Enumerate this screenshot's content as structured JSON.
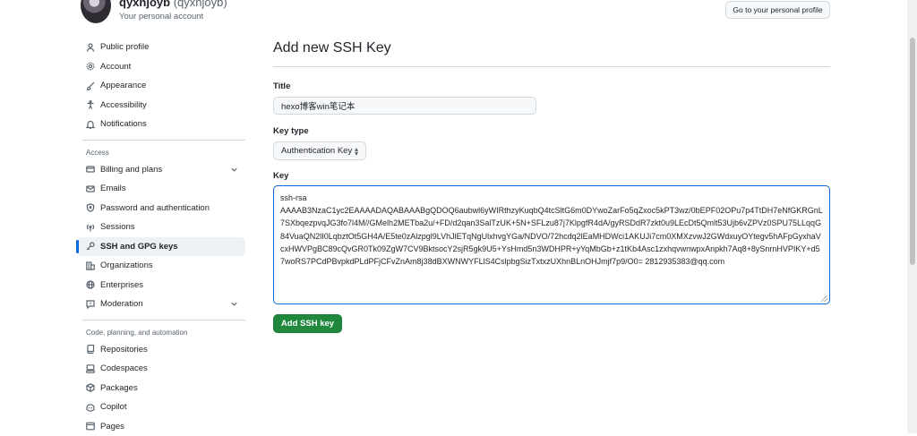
{
  "header": {
    "display_name": "qyxhjoyb",
    "login": "(qyxhjoyb)",
    "subtitle": "Your personal account",
    "profile_button": "Go to your personal profile"
  },
  "sidebar": {
    "items_top": [
      {
        "label": "Public profile",
        "icon": "person-icon"
      },
      {
        "label": "Account",
        "icon": "gear-icon"
      },
      {
        "label": "Appearance",
        "icon": "paintbrush-icon"
      },
      {
        "label": "Accessibility",
        "icon": "accessibility-icon"
      },
      {
        "label": "Notifications",
        "icon": "bell-icon"
      }
    ],
    "section_access": "Access",
    "items_access": [
      {
        "label": "Billing and plans",
        "icon": "credit-card-icon"
      },
      {
        "label": "Emails",
        "icon": "mail-icon"
      },
      {
        "label": "Password and authentication",
        "icon": "shield-lock-icon"
      },
      {
        "label": "Sessions",
        "icon": "broadcast-icon"
      },
      {
        "label": "SSH and GPG keys",
        "icon": "key-icon"
      },
      {
        "label": "Organizations",
        "icon": "organization-icon"
      },
      {
        "label": "Enterprises",
        "icon": "globe-icon"
      },
      {
        "label": "Moderation",
        "icon": "report-icon"
      }
    ],
    "section_code": "Code, planning, and automation",
    "items_code": [
      {
        "label": "Repositories",
        "icon": "repo-icon"
      },
      {
        "label": "Codespaces",
        "icon": "codespaces-icon"
      },
      {
        "label": "Packages",
        "icon": "package-icon"
      },
      {
        "label": "Copilot",
        "icon": "copilot-icon"
      },
      {
        "label": "Pages",
        "icon": "browser-icon"
      }
    ]
  },
  "main": {
    "page_title": "Add new SSH Key",
    "title_label": "Title",
    "title_value": "hexo博客win笔记本",
    "key_type_label": "Key type",
    "key_type_value": "Authentication Key",
    "key_label": "Key",
    "key_line1": "ssh-rsa",
    "key_value": "AAAAB3NzaC1yc2EAAAADAQABAAABgQDOQ6aubwl6yWIRthzyKuqbQ4tcSltG6m0DYwoZarFo5qZxoc5kPT3wz/0bEPF02OPu7p4TtDH7eNfGKRGnL7SXbqezpvqJG3fo7l4M//GMelh2METba2u/+FD/d2qan3SalTzUK+5N+SFLzu87j7KlpgfR4dA/gyRSDdR7zkt0u9LEcDt5Qmlt53Ujb6vZPVz0SPU75LLqqG84VuaQN2lI0LqbztOt5GH4A/E5te0zAlzpgl9LVhJlETqNgUlxhvgYGa/NDVO/72hcdq2lEaMHDWci1AKUJi7cm0XMXzvwJ2GWdxuyOYtegv5hAFpGyxhaVcxHWVPgBC89cQvGR0Tk09ZgW7CV9BktsocY2sjR5gk9U5+YsHmd5n3WDHPR+yYqMbGb+z1tKb4Asc1zxhqvwnwpxAnpkh7Aq8+8ySnrnHVPIKY+d57woRS7PCdPBvpkdPLdPFjCFvZnAm8j38dBXWNWYFLlS4CslpbgSizTxtxzUXhnBLnOHJmjf7p9/O0= 2812935383@qq.com",
    "submit_label": "Add SSH key"
  }
}
